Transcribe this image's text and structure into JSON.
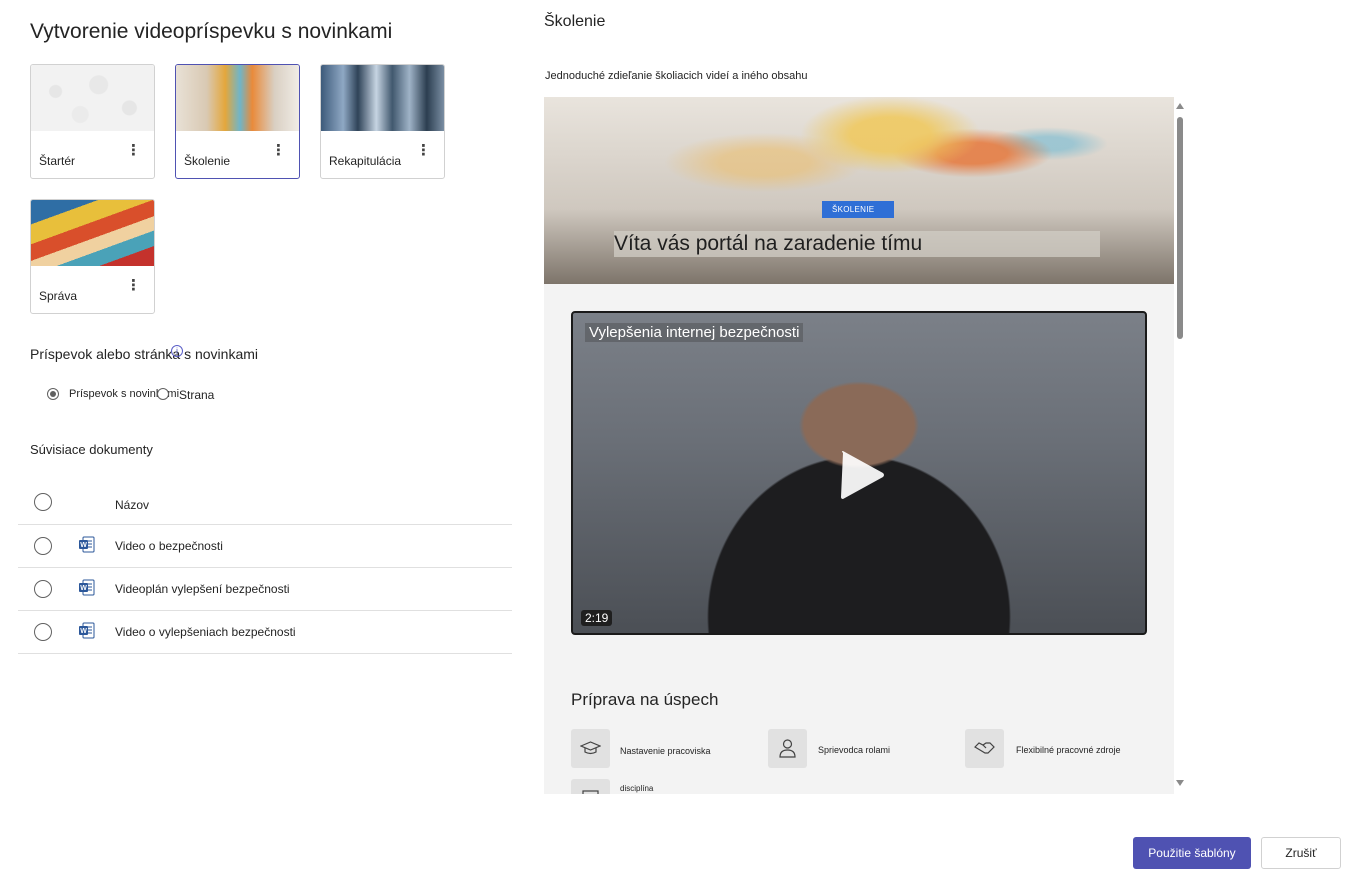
{
  "dialog": {
    "title": "Vytvorenie videopríspevku s novinkami"
  },
  "templates": [
    {
      "label": "Štartér",
      "selected": false
    },
    {
      "label": "Školenie",
      "selected": true
    },
    {
      "label": "Rekapitulácia",
      "selected": false
    },
    {
      "label": "Správa",
      "selected": false
    }
  ],
  "post_type": {
    "label": "Príspevok alebo stránka s novinkami",
    "options": [
      {
        "label": "Príspevok s novinkami",
        "checked": true
      },
      {
        "label": "Strana",
        "checked": false
      }
    ]
  },
  "related_docs": {
    "label": "Súvisiace dokumenty",
    "header": "Názov",
    "rows": [
      {
        "name": "Video o bezpečnosti",
        "icon": "word-doc-icon"
      },
      {
        "name": "Videoplán vylepšení bezpečnosti",
        "icon": "word-doc-icon"
      },
      {
        "name": "Video o vylepšeniach bezpečnosti",
        "icon": "word-doc-icon"
      }
    ]
  },
  "preview": {
    "title": "Školenie",
    "description": "Jednoduché zdieľanie školiacich videí a iného obsahu",
    "hero_tag": "ŠKOLENIE",
    "hero_headline": "Víta vás portál na zaradenie tímu",
    "video_title": "Vylepšenia internej bezpečnosti",
    "video_duration": "2:19",
    "section_heading": "Príprava na úspech",
    "features": [
      {
        "label": "Nastavenie pracoviska",
        "icon": "graduation-cap-icon"
      },
      {
        "label": "Sprievodca rolami",
        "icon": "person-icon"
      },
      {
        "label": "Flexibilné pracovné zdroje",
        "icon": "handshake-icon"
      },
      {
        "label": "disciplína",
        "icon": "board-icon"
      }
    ]
  },
  "footer": {
    "apply_label": "Použitie šablóny",
    "cancel_label": "Zrušiť"
  },
  "colors": {
    "accent": "#4f52b2",
    "hero_tag": "#2f6fd6"
  }
}
